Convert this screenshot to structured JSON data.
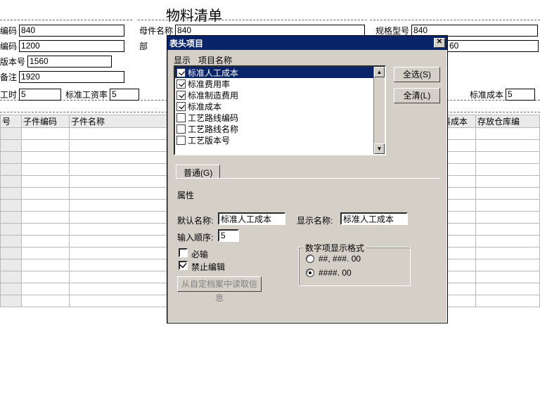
{
  "page_title": "物料清单",
  "bg_fields": {
    "code_label": "编码",
    "code_val": "840",
    "parent_name_label": "母件名称",
    "parent_name_val": "840",
    "spec_label": "规格型号",
    "spec_val": "840",
    "dept_code_label": "编码",
    "dept_code_val": "1200",
    "dept2_val": "60",
    "version_label": "版本号",
    "version_val": "1560",
    "remark_label": "备注",
    "remark_val": "1920",
    "hours_label": "工时",
    "hours_val": "5",
    "std_rate_label": "标准工资率",
    "std_rate_val": "5",
    "std_cost_label": "标准成本",
    "std_cost_val": "5",
    "partial_label_bu": "部"
  },
  "columns": {
    "c0": "号",
    "c1": "子件编码",
    "c2": "子件名称",
    "c3": "料成本",
    "c4": "存放仓库编"
  },
  "dialog": {
    "title": "表头项目",
    "header_show": "显示",
    "header_name": "项目名称",
    "items": [
      {
        "label": "标准人工成本",
        "checked": true,
        "selected": true
      },
      {
        "label": "标准费用率",
        "checked": true,
        "selected": false
      },
      {
        "label": "标准制造费用",
        "checked": true,
        "selected": false
      },
      {
        "label": "标准成本",
        "checked": true,
        "selected": false
      },
      {
        "label": "工艺路线编码",
        "checked": false,
        "selected": false
      },
      {
        "label": "工艺路线名称",
        "checked": false,
        "selected": false
      },
      {
        "label": "工艺版本号",
        "checked": false,
        "selected": false
      }
    ],
    "select_all": "全选(S)",
    "clear_all": "全清(L)",
    "tab_general": "普通(G)",
    "attr_label": "属性",
    "default_name_label": "默认名称:",
    "default_name_val": "标准人工成本",
    "display_name_label": "显示名称:",
    "display_name_val": "标准人工成本",
    "order_label": "输入顺序:",
    "order_val": "5",
    "required_label": "必输",
    "required_checked": false,
    "readonly_label": "禁止编辑",
    "readonly_checked": true,
    "read_archive_btn": "从自定档案中读取信息",
    "num_format_label": "数字项显示格式",
    "fmt1": "##, ###. 00",
    "fmt1_sel": false,
    "fmt2": "####. 00",
    "fmt2_sel": true
  }
}
